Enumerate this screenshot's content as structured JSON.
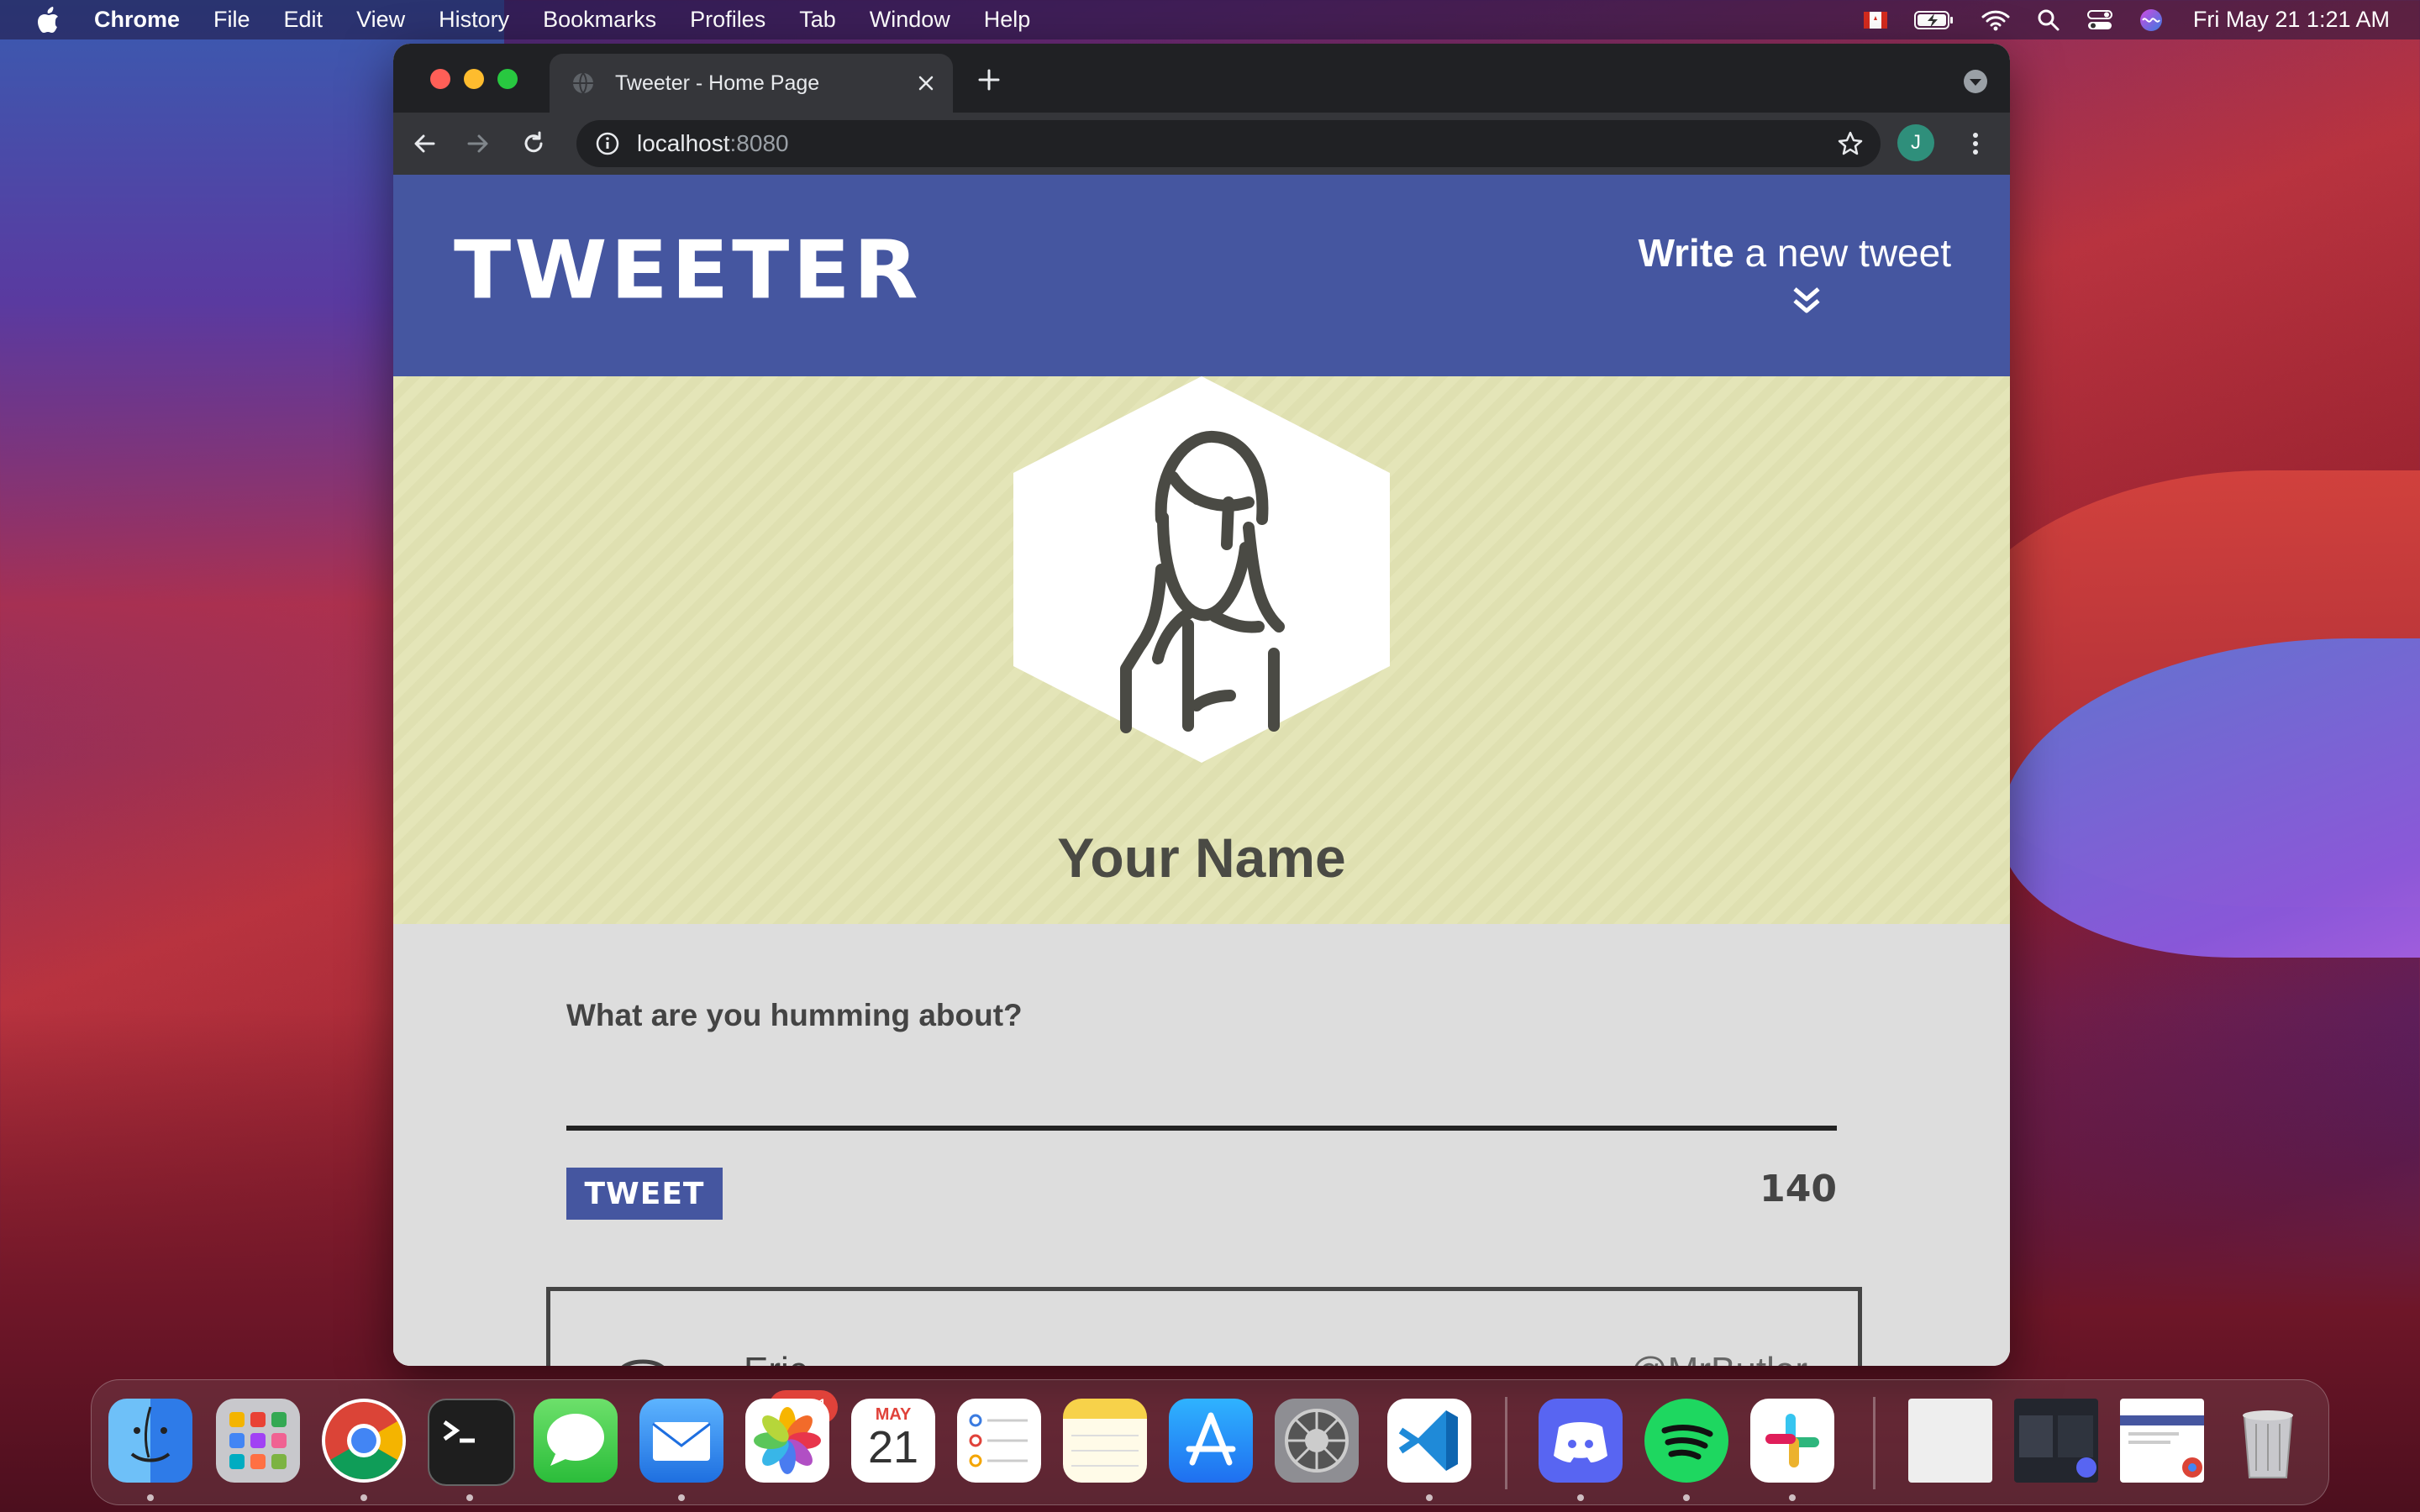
{
  "menubar": {
    "app_name": "Chrome",
    "items": [
      "File",
      "Edit",
      "View",
      "History",
      "Bookmarks",
      "Profiles",
      "Tab",
      "Window",
      "Help"
    ],
    "clock": "Fri May 21  1:21 AM"
  },
  "browser": {
    "tab_title": "Tweeter - Home Page",
    "url_host": "localhost",
    "url_port": ":8080",
    "profile_initial": "J"
  },
  "nav": {
    "logo": "TWEETER",
    "compose_bold": "Write",
    "compose_rest": " a new tweet"
  },
  "header": {
    "username": "Your Name"
  },
  "composer": {
    "prompt": "What are you humming about?",
    "tweet_button": "TWEET",
    "counter": "140"
  },
  "tweet": {
    "name": "Eric",
    "handle": "@MrButler"
  },
  "dock": {
    "mail_badge": "4,611",
    "calendar_month": "MAY",
    "calendar_day": "21"
  },
  "colors": {
    "nav_bg": "#4556a0",
    "header_bg": "#e4e5b8",
    "composer_bg": "#dddddd",
    "text_dark": "#444444"
  }
}
